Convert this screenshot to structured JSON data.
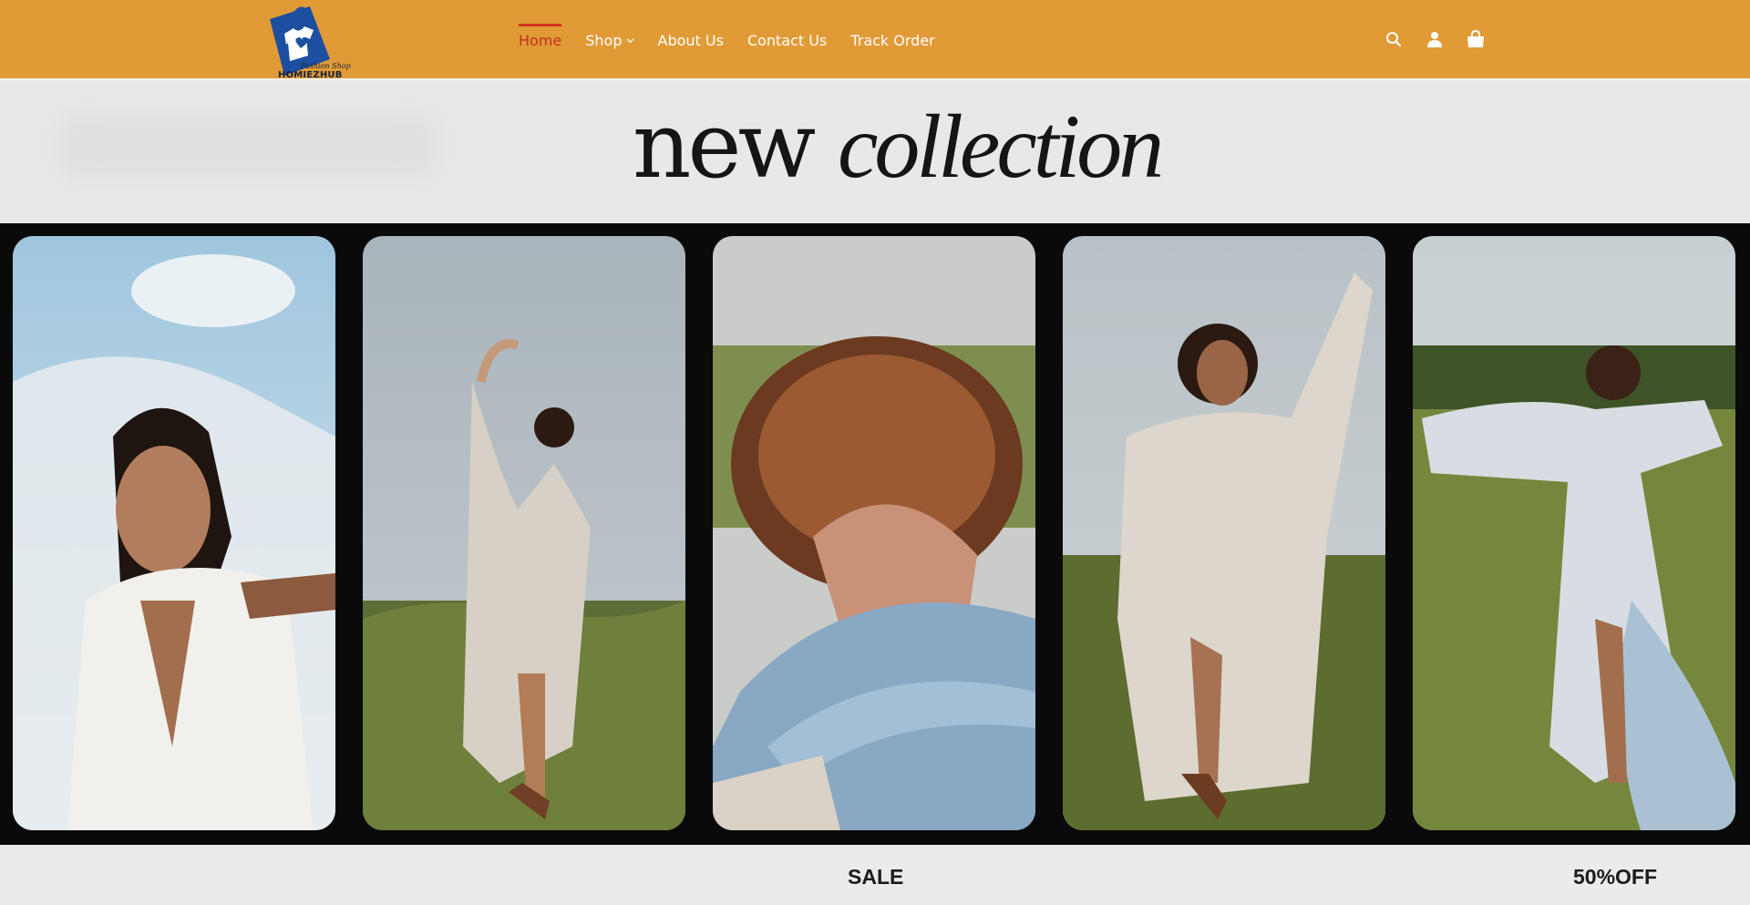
{
  "brand": {
    "name": "HOMIEZHUB",
    "tagline": "Fashion Shop"
  },
  "nav": {
    "items": [
      {
        "label": "Home",
        "active": true
      },
      {
        "label": "Shop",
        "has_dropdown": true
      },
      {
        "label": "About Us"
      },
      {
        "label": "Contact Us"
      },
      {
        "label": "Track Order"
      }
    ]
  },
  "header_icons": [
    "search-icon",
    "user-icon",
    "shopping-bag-icon"
  ],
  "banner": {
    "word1": "new",
    "word2": "collection"
  },
  "promo": {
    "sale": "SALE",
    "discount": "50%OFF"
  },
  "colors": {
    "header_bg": "#e09a36",
    "nav_active": "#c62f1f",
    "logo_blue": "#1d4fa0"
  }
}
